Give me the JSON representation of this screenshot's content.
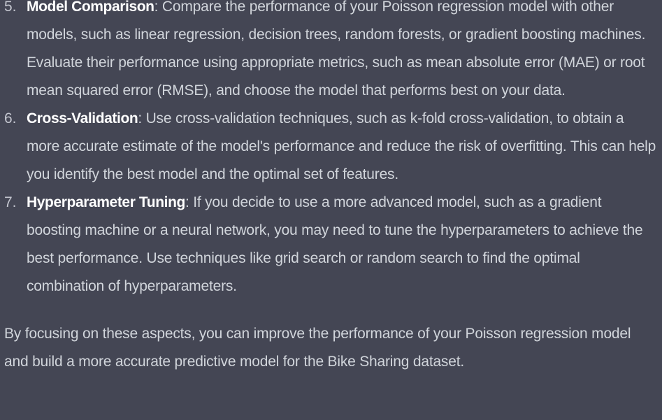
{
  "list": [
    {
      "number": "5.",
      "term": "Model Comparison",
      "text": ": Compare the performance of your Poisson regression model with other models, such as linear regression, decision trees, random forests, or gradient boosting machines. Evaluate their performance using appropriate metrics, such as mean absolute error (MAE) or root mean squared error (RMSE), and choose the model that performs best on your data."
    },
    {
      "number": "6.",
      "term": "Cross-Validation",
      "text": ": Use cross-validation techniques, such as k-fold cross-validation, to obtain a more accurate estimate of the model's performance and reduce the risk of overfitting. This can help you identify the best model and the optimal set of features."
    },
    {
      "number": "7.",
      "term": "Hyperparameter Tuning",
      "text": ": If you decide to use a more advanced model, such as a gradient boosting machine or a neural network, you may need to tune the hyperparameters to achieve the best performance. Use techniques like grid search or random search to find the optimal combination of hyperparameters."
    }
  ],
  "conclusion": "By focusing on these aspects, you can improve the performance of your Poisson regression model and build a more accurate predictive model for the Bike Sharing dataset."
}
